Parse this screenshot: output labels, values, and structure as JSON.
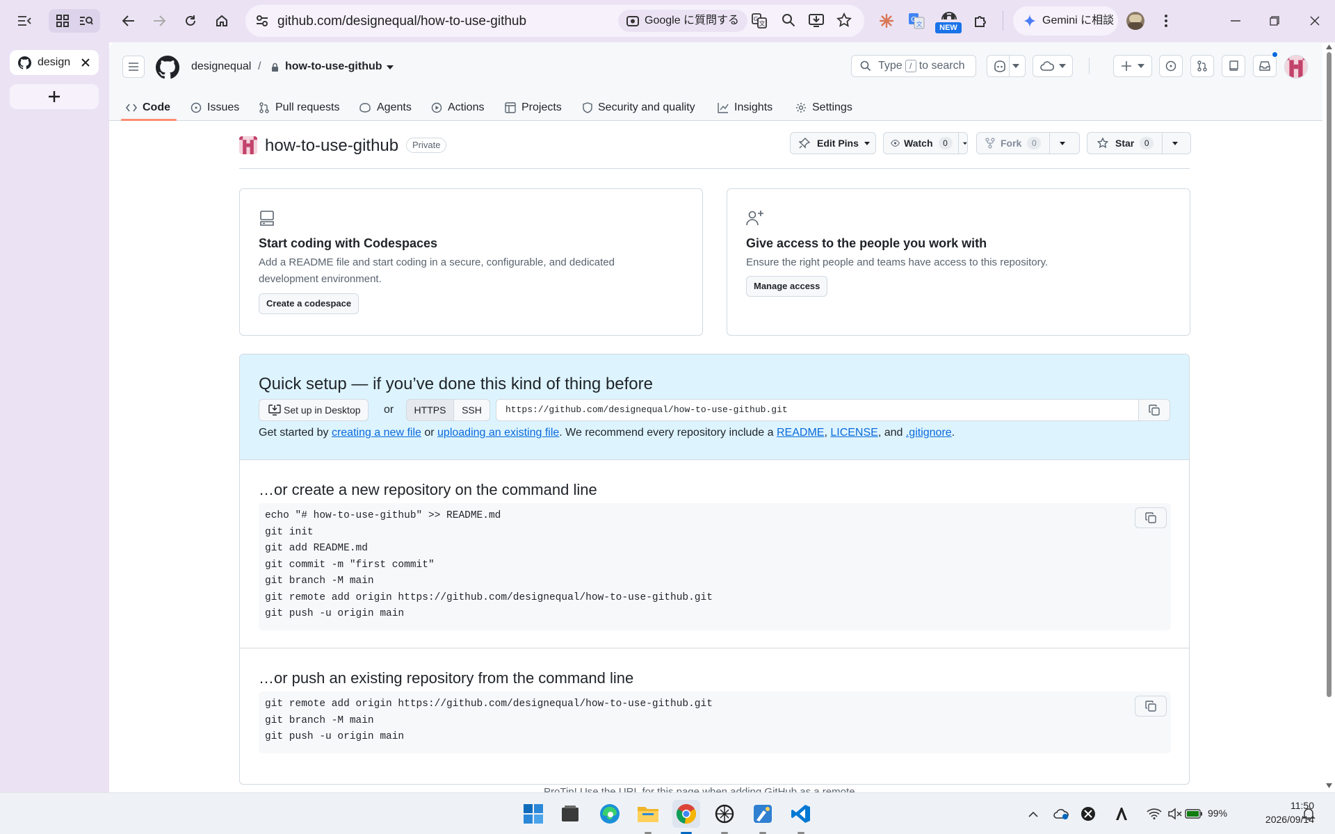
{
  "browser": {
    "tab_title": "design",
    "url": "github.com/designequal/how-to-use-github",
    "google_ask": "Google に質問する",
    "new_badge": "NEW",
    "gemini": "Gemini に相談"
  },
  "gh": {
    "owner": "designequal",
    "separator": "/",
    "repo": "how-to-use-github",
    "search_prefix": "Type",
    "search_key": "/",
    "search_suffix": "to search",
    "nav": [
      "Code",
      "Issues",
      "Pull requests",
      "Agents",
      "Actions",
      "Projects",
      "Security and quality",
      "Insights",
      "Settings"
    ]
  },
  "repo": {
    "title": "how-to-use-github",
    "visibility": "Private",
    "edit_pins": "Edit Pins",
    "watch": "Watch",
    "watch_count": "0",
    "fork": "Fork",
    "fork_count": "0",
    "star": "Star",
    "star_count": "0"
  },
  "cards": {
    "codespaces_title": "Start coding with Codespaces",
    "codespaces_desc": "Add a README file and start coding in a secure, configurable, and dedicated development environment.",
    "codespaces_btn": "Create a codespace",
    "access_title": "Give access to the people you work with",
    "access_desc": "Ensure the right people and teams have access to this repository.",
    "access_btn": "Manage access"
  },
  "quick": {
    "title": "Quick setup — if you’ve done this kind of thing before",
    "desktop_btn": "Set up in Desktop",
    "or": "or",
    "https": "HTTPS",
    "ssh": "SSH",
    "clone_url": "https://github.com/designequal/how-to-use-github.git",
    "gs_1": "Get started by ",
    "link_new": "creating a new file",
    "gs_2": " or ",
    "link_upload": "uploading an existing file",
    "gs_3": ". We recommend every repository include a ",
    "link_readme": "README",
    "gs_4": ", ",
    "link_license": "LICENSE",
    "gs_5": ", and ",
    "link_gitignore": ".gitignore",
    "gs_6": "."
  },
  "create_section": {
    "title": "…or create a new repository on the command line",
    "lines": [
      "echo \"# how-to-use-github\" >> README.md",
      "git init",
      "git add README.md",
      "git commit -m \"first commit\"",
      "git branch -M main",
      "git remote add origin https://github.com/designequal/how-to-use-github.git",
      "git push -u origin main"
    ]
  },
  "push_section": {
    "title": "…or push an existing repository from the command line",
    "lines": [
      "git remote add origin https://github.com/designequal/how-to-use-github.git",
      "git branch -M main",
      "git push -u origin main"
    ]
  },
  "protip": "ProTip! Use the URL for this page when adding GitHub as a remote.",
  "taskbar": {
    "battery": "99%",
    "time": "11:50",
    "date": "2026/09/14"
  },
  "colors": {
    "chrome_bg": "#ebe3f4",
    "gh_header_bg": "#f6f8fa",
    "quick_setup_bg": "#ddf4ff",
    "link": "#0969da",
    "nav_underline": "#fd8c73"
  }
}
